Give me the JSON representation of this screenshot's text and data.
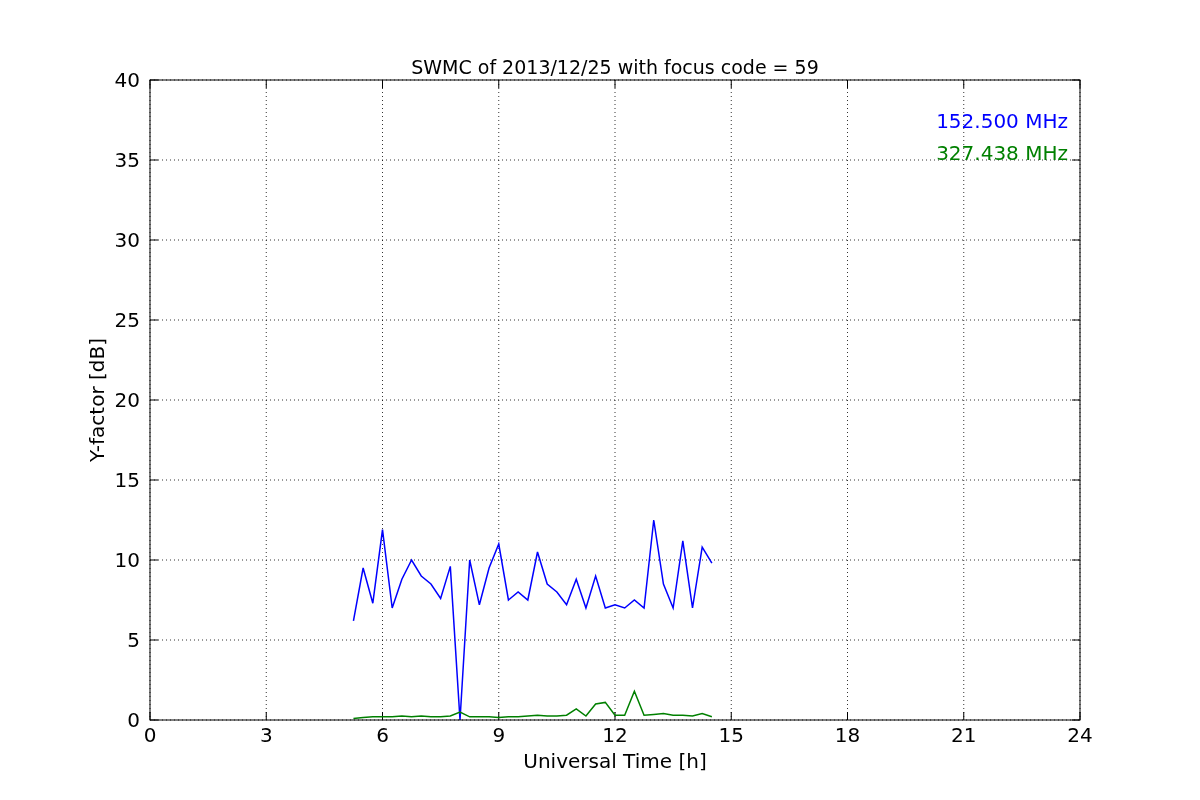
{
  "chart_data": {
    "type": "line",
    "title": "SWMC of 2013/12/25 with focus code = 59",
    "xlabel": "Universal Time [h]",
    "ylabel": "Y-factor [dB]",
    "x": [
      5.25,
      5.5,
      5.75,
      6.0,
      6.25,
      6.5,
      6.75,
      7.0,
      7.25,
      7.5,
      7.75,
      8.0,
      8.25,
      8.5,
      8.75,
      9.0,
      9.25,
      9.5,
      9.75,
      10.0,
      10.25,
      10.5,
      10.75,
      11.0,
      11.25,
      11.5,
      11.75,
      12.0,
      12.25,
      12.5,
      12.75,
      13.0,
      13.25,
      13.5,
      13.75,
      14.0,
      14.25,
      14.5
    ],
    "series": [
      {
        "name": "152.500 MHz",
        "color": "#0000ff",
        "values": [
          6.2,
          9.5,
          7.3,
          11.9,
          7.0,
          8.8,
          10.0,
          9.0,
          8.5,
          7.6,
          9.6,
          0.0,
          10.0,
          7.2,
          9.5,
          11.0,
          7.5,
          8.0,
          7.5,
          10.5,
          8.5,
          8.0,
          7.2,
          8.8,
          7.0,
          9.0,
          7.0,
          7.2,
          7.0,
          7.5,
          7.0,
          12.5,
          8.5,
          7.0,
          11.2,
          7.0,
          10.8,
          9.8
        ]
      },
      {
        "name": "327.438 MHz",
        "color": "#008000",
        "values": [
          0.1,
          0.15,
          0.2,
          0.2,
          0.2,
          0.25,
          0.2,
          0.25,
          0.2,
          0.2,
          0.25,
          0.5,
          0.2,
          0.2,
          0.2,
          0.15,
          0.2,
          0.2,
          0.25,
          0.3,
          0.25,
          0.25,
          0.3,
          0.7,
          0.25,
          1.0,
          1.1,
          0.3,
          0.3,
          1.8,
          0.3,
          0.35,
          0.4,
          0.3,
          0.3,
          0.25,
          0.4,
          0.2
        ]
      }
    ],
    "grid": true,
    "xlim": [
      0,
      24
    ],
    "ylim": [
      0,
      40
    ],
    "xticks": [
      0,
      3,
      6,
      9,
      12,
      15,
      18,
      21,
      24
    ],
    "yticks": [
      0,
      5,
      10,
      15,
      20,
      25,
      30,
      35,
      40
    ]
  }
}
